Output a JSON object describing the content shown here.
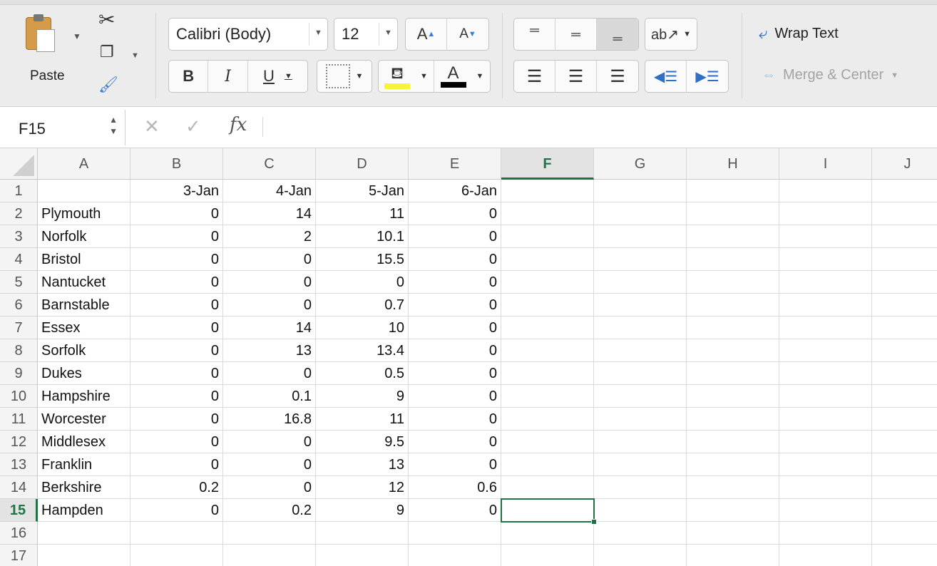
{
  "ribbon": {
    "paste_label": "Paste",
    "font_name": "Calibri (Body)",
    "font_size": "12",
    "wrap_text": "Wrap Text",
    "merge_center": "Merge & Center",
    "bold": "B",
    "italic": "I",
    "underline": "U",
    "grow_font": "A",
    "shrink_font": "A",
    "font_color_letter": "A",
    "fill_color": "#f5f53a",
    "font_color": "#000000"
  },
  "formula_bar": {
    "name_box": "F15",
    "fx_label": "fx",
    "formula": ""
  },
  "sheet": {
    "columns": [
      "A",
      "B",
      "C",
      "D",
      "E",
      "F",
      "G",
      "H",
      "I",
      "J"
    ],
    "selected_column": "F",
    "selected_row": "15",
    "rows": [
      {
        "num": "1",
        "cells": [
          "",
          "3-Jan",
          "4-Jan",
          "5-Jan",
          "6-Jan"
        ]
      },
      {
        "num": "2",
        "cells": [
          "Plymouth",
          "0",
          "14",
          "11",
          "0"
        ]
      },
      {
        "num": "3",
        "cells": [
          "Norfolk",
          "0",
          "2",
          "10.1",
          "0"
        ]
      },
      {
        "num": "4",
        "cells": [
          "Bristol",
          "0",
          "0",
          "15.5",
          "0"
        ]
      },
      {
        "num": "5",
        "cells": [
          "Nantucket",
          "0",
          "0",
          "0",
          "0"
        ]
      },
      {
        "num": "6",
        "cells": [
          "Barnstable",
          "0",
          "0",
          "0.7",
          "0"
        ]
      },
      {
        "num": "7",
        "cells": [
          "Essex",
          "0",
          "14",
          "10",
          "0"
        ]
      },
      {
        "num": "8",
        "cells": [
          "Sorfolk",
          "0",
          "13",
          "13.4",
          "0"
        ]
      },
      {
        "num": "9",
        "cells": [
          "Dukes",
          "0",
          "0",
          "0.5",
          "0"
        ]
      },
      {
        "num": "10",
        "cells": [
          "Hampshire",
          "0",
          "0.1",
          "9",
          "0"
        ]
      },
      {
        "num": "11",
        "cells": [
          "Worcester",
          "0",
          "16.8",
          "11",
          "0"
        ]
      },
      {
        "num": "12",
        "cells": [
          "Middlesex",
          "0",
          "0",
          "9.5",
          "0"
        ]
      },
      {
        "num": "13",
        "cells": [
          "Franklin",
          "0",
          "0",
          "13",
          "0"
        ]
      },
      {
        "num": "14",
        "cells": [
          "Berkshire",
          "0.2",
          "0",
          "12",
          "0.6"
        ]
      },
      {
        "num": "15",
        "cells": [
          "Hampden",
          "0",
          "0.2",
          "9",
          "0"
        ]
      },
      {
        "num": "16",
        "cells": [
          "",
          "",
          "",
          "",
          ""
        ]
      },
      {
        "num": "17",
        "cells": [
          "",
          "",
          "",
          "",
          ""
        ]
      }
    ]
  }
}
